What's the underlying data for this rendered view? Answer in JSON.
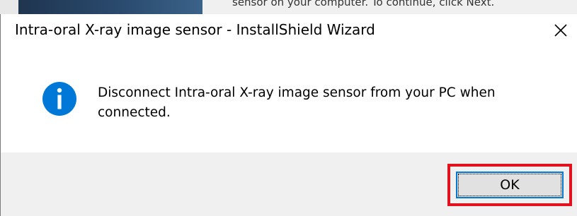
{
  "background_window": {
    "partial_text": "sensor on your computer.  To continue, click Next."
  },
  "dialog": {
    "title": "Intra-oral X-ray image sensor - InstallShield Wizard",
    "message": "Disconnect Intra-oral X-ray image sensor from your PC when connected.",
    "icon": "info-icon",
    "close_icon": "close-icon"
  },
  "buttons": {
    "ok_label": "OK"
  },
  "colors": {
    "info_icon": "#0078d7",
    "highlight": "#e3101e",
    "button_focus": "#0078d7",
    "footer": "#f0f0f0"
  }
}
